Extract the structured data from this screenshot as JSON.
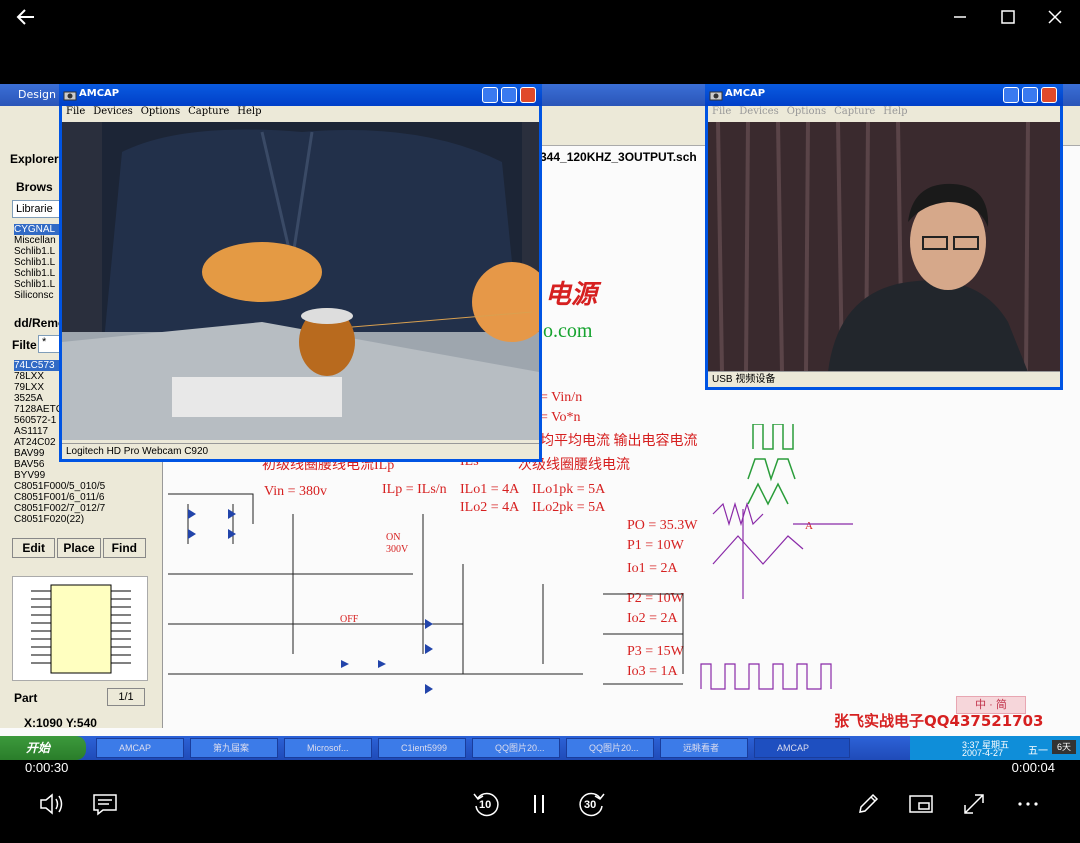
{
  "player": {
    "time_elapsed": "0:00:30",
    "time_remaining": "0:00:04",
    "skip_back_label": "10",
    "skip_forward_label": "30"
  },
  "desktop": {
    "design_title": "Design",
    "explorer_label": "Explorer",
    "browse_label": "Brows",
    "libraries_label": "Librarie",
    "libraries": [
      "CYGNAL",
      "Miscellan",
      "Schlib1.L",
      "Schlib1.L",
      "Schlib1.L",
      "Schlib1.L",
      "Siliconsc"
    ],
    "add_remove_label": "dd/Remo",
    "filter_label": "Filte",
    "filter_value": "*",
    "components": [
      "74LC573",
      "78LXX",
      "79LXX",
      "3525A",
      "7128AETC",
      "560572-1",
      "AS1117",
      "AT24C02",
      "BAV99",
      "BAV56",
      "BYV99",
      "C8051F000/5_010/5",
      "C8051F001/6_011/6",
      "C8051F002/7_012/7",
      "C8051F020(22)"
    ],
    "edit_label": "Edit",
    "place_label": "Place",
    "find_label": "Find",
    "part_label": "Part",
    "part_page": "1/1",
    "coords": "X:1090 Y:540",
    "schematic_tab": "344_120KHZ_3OUTPUT.sch",
    "watermark": "张飞实战电子QQ437521703",
    "ime_label": "中 · 简",
    "start_label": "开始",
    "tasks": [
      "AMCAP",
      "第九届案",
      "Microsof...",
      "C1ient5999",
      "QQ图片20...",
      "QQ图片20...",
      "远眺看者",
      "AMCAP"
    ],
    "clock_time": "3:37 星期五",
    "clock_date": "2007-4-27",
    "tray_day": "五一",
    "tray_days": "6天"
  },
  "schematic": {
    "heading_suffix": "电源",
    "url_suffix": "o.com",
    "vin_n": "= Vin/n",
    "vo_n": "= Vo*n",
    "avg_current": "均平均电流 输出电容电流",
    "primary_current": "初级线圈腰线电流ILp",
    "ils": "ILs",
    "secondary_current": "次级线圈腰线电流",
    "vin": "Vin = 380v",
    "ilp_eq": "ILp = ILs/n",
    "ilo1": "ILo1 = 4A",
    "ilo1pk": "ILo1pk = 5A",
    "ilo2": "ILo2 = 4A",
    "ilo2pk": "ILo2pk = 5A",
    "po": "PO = 35.3W",
    "p1": "P1 = 10W",
    "io1": "Io1 = 2A",
    "p2": "P2 = 10W",
    "io2": "Io2 = 2A",
    "p3": "P3 = 15W",
    "io3": "Io3 = 1A",
    "on": "ON",
    "off": "OFF",
    "v300": "300V",
    "label_a": "A"
  },
  "amcap_main": {
    "title": "AMCAP",
    "menu": [
      "File",
      "Devices",
      "Options",
      "Capture",
      "Help"
    ],
    "status": "Logitech HD Pro Webcam C920"
  },
  "amcap_side": {
    "title": "AMCAP",
    "menu": [
      "File",
      "Devices",
      "Options",
      "Capture",
      "Help"
    ],
    "status": "USB 视频设备"
  },
  "colors": {
    "xp_blue": "#0054e3",
    "schematic_red": "#d62020",
    "schematic_green": "#16a32f"
  }
}
